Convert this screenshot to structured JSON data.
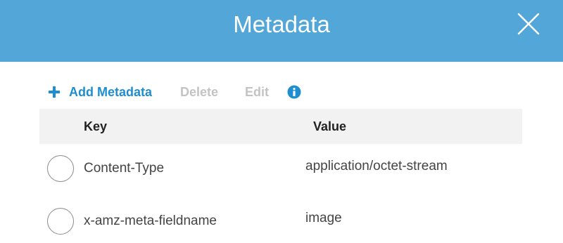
{
  "colors": {
    "header_bg": "#52a6d8",
    "link": "#1f8ed0",
    "disabled": "#c3c3c3"
  },
  "header": {
    "title": "Metadata",
    "close_icon": "close-icon"
  },
  "toolbar": {
    "add_label": "Add Metadata",
    "add_icon": "plus-icon",
    "delete_label": "Delete",
    "edit_label": "Edit",
    "info_icon": "info-icon"
  },
  "table": {
    "columns": [
      "Key",
      "Value"
    ],
    "rows": [
      {
        "key": "Content-Type",
        "value": "application/octet-stream",
        "selected": false
      },
      {
        "key": "x-amz-meta-fieldname",
        "value": "image",
        "selected": false
      }
    ]
  }
}
